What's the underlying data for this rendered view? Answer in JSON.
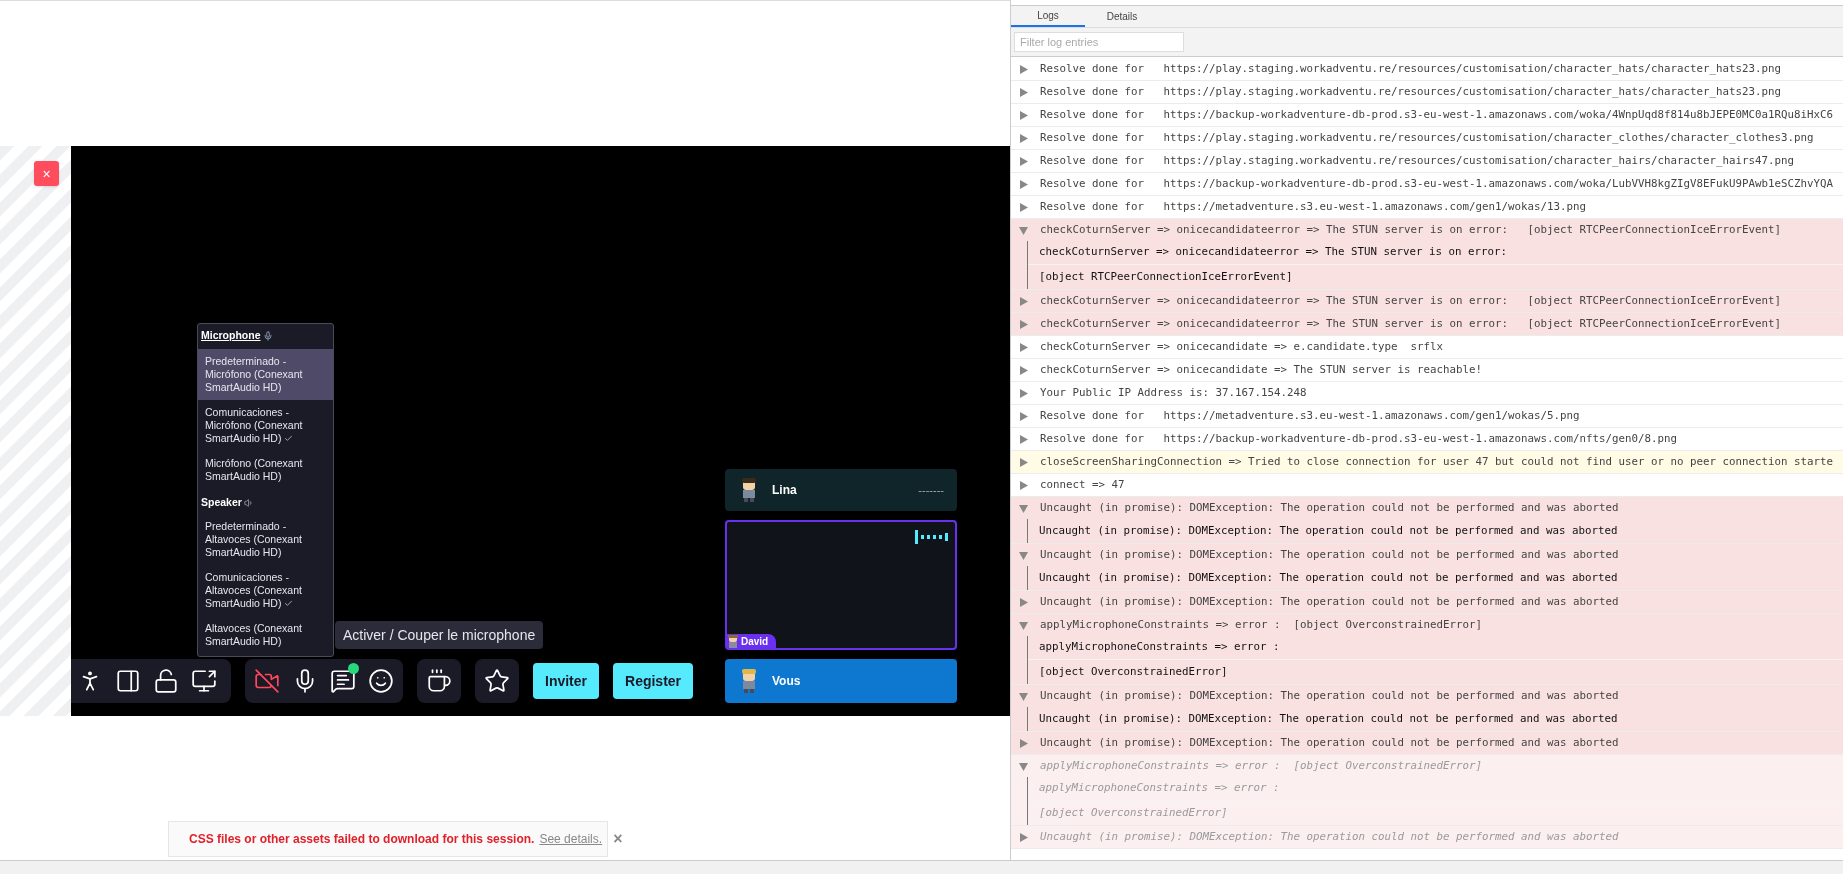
{
  "game": {
    "close_button": "×",
    "microphone_menu": {
      "microphone_title": "Microphone",
      "microphones": [
        {
          "label": "Predeterminado - Micrófono (Conexant SmartAudio HD)",
          "highlighted": true,
          "checked": false
        },
        {
          "label": "Comunicaciones - Micrófono (Conexant SmartAudio HD)",
          "highlighted": false,
          "checked": true
        },
        {
          "label": "Micrófono (Conexant SmartAudio HD)",
          "highlighted": false,
          "checked": false
        }
      ],
      "speaker_title": "Speaker",
      "speakers": [
        {
          "label": "Predeterminado - Altavoces (Conexant SmartAudio HD)",
          "highlighted": false,
          "checked": false
        },
        {
          "label": "Comunicaciones - Altavoces (Conexant SmartAudio HD)",
          "highlighted": false,
          "checked": true
        },
        {
          "label": "Altavoces (Conexant SmartAudio HD)",
          "highlighted": false,
          "checked": false
        }
      ]
    },
    "tooltip": "Activer / Couper le microphone",
    "toolbar_groups": [
      {
        "items": [
          {
            "kind": "follow"
          },
          {
            "kind": "layout"
          },
          {
            "kind": "lock"
          },
          {
            "kind": "screen"
          }
        ]
      },
      {
        "items": [
          {
            "kind": "camera",
            "off": true
          },
          {
            "kind": "mic"
          },
          {
            "kind": "chat",
            "notification": true
          },
          {
            "kind": "emoji"
          }
        ]
      },
      {
        "items": [
          {
            "kind": "coffee"
          }
        ]
      },
      {
        "items": [
          {
            "kind": "star"
          }
        ]
      }
    ],
    "buttons": [
      "Inviter",
      "Register"
    ],
    "participants": [
      {
        "kind": "remote",
        "name": "Lina",
        "status": "-------"
      },
      {
        "kind": "video",
        "name": "David"
      }
    ],
    "self": {
      "name": "Vous"
    }
  },
  "banner": {
    "message": "CSS files or other assets failed to download for this session.",
    "link": "See details.",
    "close": "×"
  },
  "devtools": {
    "tabs": [
      {
        "label": "Logs",
        "selected": true
      },
      {
        "label": "Details",
        "selected": false
      }
    ],
    "filter": {
      "placeholder": "Filter log entries"
    },
    "entries": [
      {
        "kind": "info",
        "expanded": false,
        "faded": false,
        "text": "Resolve done for   https://play.staging.workadventu.re/resources/customisation/character_hats/character_hats23.png"
      },
      {
        "kind": "info",
        "expanded": false,
        "faded": false,
        "text": "Resolve done for   https://play.staging.workadventu.re/resources/customisation/character_hats/character_hats23.png"
      },
      {
        "kind": "info",
        "expanded": false,
        "faded": false,
        "text": "Resolve done for   https://backup-workadventure-db-prod.s3-eu-west-1.amazonaws.com/woka/4WnpUqd8f814u8bJEPE0MC0a1RQu8iHxC6"
      },
      {
        "kind": "info",
        "expanded": false,
        "faded": false,
        "text": "Resolve done for   https://play.staging.workadventu.re/resources/customisation/character_clothes/character_clothes3.png"
      },
      {
        "kind": "info",
        "expanded": false,
        "faded": false,
        "text": "Resolve done for   https://play.staging.workadventu.re/resources/customisation/character_hairs/character_hairs47.png"
      },
      {
        "kind": "info",
        "expanded": false,
        "faded": false,
        "text": "Resolve done for   https://backup-workadventure-db-prod.s3-eu-west-1.amazonaws.com/woka/LubVVH8kgZIgV8EFukU9PAwb1eSCZhvYQA"
      },
      {
        "kind": "info",
        "expanded": false,
        "faded": false,
        "text": "Resolve done for   https://metadventure.s3.eu-west-1.amazonaws.com/gen1/wokas/13.png"
      },
      {
        "kind": "error",
        "expanded": true,
        "faded": false,
        "text": "checkCoturnServer => onicecandidateerror => The STUN server is on error:   [object RTCPeerConnectionIceErrorEvent]",
        "children": [
          "checkCoturnServer => onicecandidateerror => The STUN server is on error:",
          "[object RTCPeerConnectionIceErrorEvent]"
        ]
      },
      {
        "kind": "error",
        "expanded": false,
        "faded": false,
        "text": "checkCoturnServer => onicecandidateerror => The STUN server is on error:   [object RTCPeerConnectionIceErrorEvent]"
      },
      {
        "kind": "error",
        "expanded": false,
        "faded": false,
        "text": "checkCoturnServer => onicecandidateerror => The STUN server is on error:   [object RTCPeerConnectionIceErrorEvent]"
      },
      {
        "kind": "info",
        "expanded": false,
        "faded": false,
        "text": "checkCoturnServer => onicecandidate => e.candidate.type  srflx"
      },
      {
        "kind": "info",
        "expanded": false,
        "faded": false,
        "text": "checkCoturnServer => onicecandidate => The STUN server is reachable!"
      },
      {
        "kind": "info",
        "expanded": false,
        "faded": false,
        "text": "Your Public IP Address is: 37.167.154.248"
      },
      {
        "kind": "info",
        "expanded": false,
        "faded": false,
        "text": "Resolve done for   https://metadventure.s3.eu-west-1.amazonaws.com/gen1/wokas/5.png"
      },
      {
        "kind": "info",
        "expanded": false,
        "faded": false,
        "text": "Resolve done for   https://backup-workadventure-db-prod.s3-eu-west-1.amazonaws.com/nfts/gen0/8.png"
      },
      {
        "kind": "warning",
        "expanded": false,
        "faded": false,
        "text": "closeScreenSharingConnection => Tried to close connection for user 47 but could not find user or no peer connection starte"
      },
      {
        "kind": "info",
        "expanded": false,
        "faded": false,
        "text": "connect => 47"
      },
      {
        "kind": "error",
        "expanded": true,
        "faded": false,
        "text": "Uncaught (in promise): DOMException: The operation could not be performed and was aborted",
        "children": [
          "Uncaught (in promise): DOMException: The operation could not be performed and was aborted"
        ]
      },
      {
        "kind": "error",
        "expanded": true,
        "faded": false,
        "text": "Uncaught (in promise): DOMException: The operation could not be performed and was aborted",
        "children": [
          "Uncaught (in promise): DOMException: The operation could not be performed and was aborted"
        ]
      },
      {
        "kind": "error",
        "expanded": false,
        "faded": false,
        "text": "Uncaught (in promise): DOMException: The operation could not be performed and was aborted"
      },
      {
        "kind": "error",
        "expanded": true,
        "faded": false,
        "text": "applyMicrophoneConstraints => error :  [object OverconstrainedError]",
        "children": [
          "applyMicrophoneConstraints => error :",
          "[object OverconstrainedError]"
        ]
      },
      {
        "kind": "error",
        "expanded": true,
        "faded": false,
        "text": "Uncaught (in promise): DOMException: The operation could not be performed and was aborted",
        "children": [
          "Uncaught (in promise): DOMException: The operation could not be performed and was aborted"
        ]
      },
      {
        "kind": "error",
        "expanded": false,
        "faded": false,
        "text": "Uncaught (in promise): DOMException: The operation could not be performed and was aborted"
      },
      {
        "kind": "error",
        "expanded": true,
        "faded": true,
        "text": "applyMicrophoneConstraints => error :  [object OverconstrainedError]",
        "children": [
          "applyMicrophoneConstraints => error :",
          "[object OverconstrainedError]"
        ]
      },
      {
        "kind": "error",
        "expanded": false,
        "faded": true,
        "text": "Uncaught (in promise): DOMException: The operation could not be performed and was aborted"
      }
    ]
  }
}
